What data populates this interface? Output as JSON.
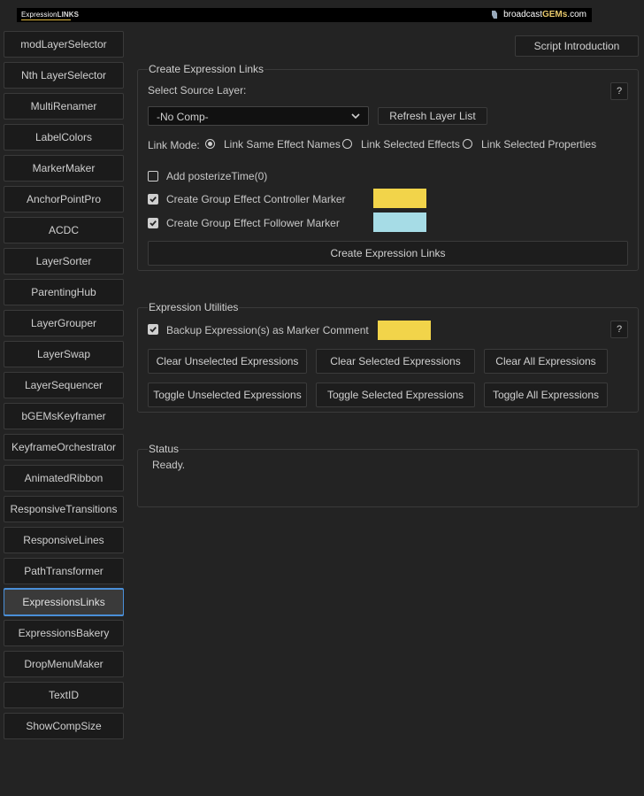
{
  "banner": {
    "logo_prefix": "Expression",
    "logo_bold": "LINKS",
    "brand_prefix": "broadcast",
    "brand_bold": "GEMs",
    "brand_suffix": ".com"
  },
  "sidebar": {
    "items": [
      {
        "label": "modLayerSelector",
        "active": false
      },
      {
        "label": "Nth LayerSelector",
        "active": false
      },
      {
        "label": "MultiRenamer",
        "active": false
      },
      {
        "label": "LabelColors",
        "active": false
      },
      {
        "label": "MarkerMaker",
        "active": false
      },
      {
        "label": "AnchorPointPro",
        "active": false
      },
      {
        "label": "ACDC",
        "active": false
      },
      {
        "label": "LayerSorter",
        "active": false
      },
      {
        "label": "ParentingHub",
        "active": false
      },
      {
        "label": "LayerGrouper",
        "active": false
      },
      {
        "label": "LayerSwap",
        "active": false
      },
      {
        "label": "LayerSequencer",
        "active": false
      },
      {
        "label": "bGEMsKeyframer",
        "active": false
      },
      {
        "label": "KeyframeOrchestrator",
        "active": false
      },
      {
        "label": "AnimatedRibbon",
        "active": false
      },
      {
        "label": "ResponsiveTransitions",
        "active": false
      },
      {
        "label": "ResponsiveLines",
        "active": false
      },
      {
        "label": "PathTransformer",
        "active": false
      },
      {
        "label": "ExpressionsLinks",
        "active": true
      },
      {
        "label": "ExpressionsBakery",
        "active": false
      },
      {
        "label": "DropMenuMaker",
        "active": false
      },
      {
        "label": "TextID",
        "active": false
      },
      {
        "label": "ShowCompSize",
        "active": false
      }
    ]
  },
  "header": {
    "intro_button": "Script Introduction"
  },
  "create_links": {
    "title": "Create Expression Links",
    "source_label": "Select Source Layer:",
    "help": "?",
    "source_value": "-No Comp-",
    "refresh_button": "Refresh Layer List",
    "link_mode_label": "Link Mode:",
    "modes": [
      {
        "label": "Link Same Effect Names",
        "selected": true
      },
      {
        "label": "Link Selected Effects",
        "selected": false
      },
      {
        "label": "Link Selected Properties",
        "selected": false
      }
    ],
    "posterize": {
      "label": "Add posterizeTime(0)",
      "checked": false
    },
    "controller_marker": {
      "label": "Create Group Effect Controller Marker",
      "checked": true,
      "color": "#f2d44a"
    },
    "follower_marker": {
      "label": "Create Group Effect Follower Marker",
      "checked": true,
      "color": "#a6dce6"
    },
    "create_button": "Create Expression Links"
  },
  "utilities": {
    "title": "Expression Utilities",
    "backup": {
      "label": "Backup Expression(s) as Marker Comment",
      "checked": true,
      "color": "#f2d44a"
    },
    "help": "?",
    "clear_unselected": "Clear Unselected Expressions",
    "clear_selected": "Clear Selected Expressions",
    "clear_all": "Clear All Expressions",
    "toggle_unselected": "Toggle Unselected Expressions",
    "toggle_selected": "Toggle Selected Expressions",
    "toggle_all": "Toggle All Expressions"
  },
  "status": {
    "title": "Status",
    "text": "Ready."
  },
  "colors": {
    "background": "#232323",
    "active_accent": "#4a8fd8",
    "brand_gold": "#e6c76a"
  }
}
